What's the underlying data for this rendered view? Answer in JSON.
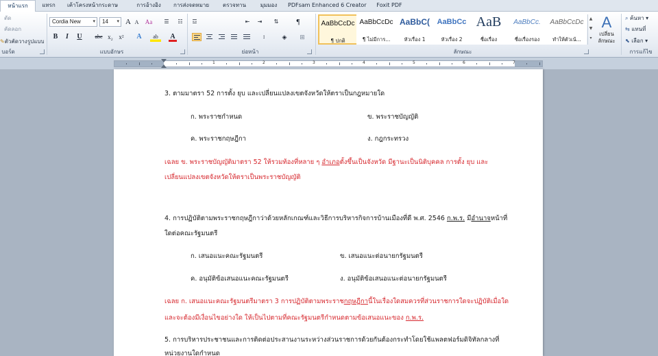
{
  "tabs": [
    "หน้าแรก",
    "แทรก",
    "เค้าโครงหน้ากระดาษ",
    "การอ้างอิง",
    "การส่งจดหมาย",
    "ตรวจทาน",
    "มุมมอง",
    "PDFsam Enhanced 6 Creator",
    "Foxit PDF"
  ],
  "clipboard": {
    "cut": "ตัด",
    "copy": "คัดลอก",
    "format_painter": "ตัวคัดวางรูปแบบ",
    "group_label": "บอร์ด"
  },
  "font": {
    "name": "Cordia New",
    "size": "14",
    "group_label": "แบบอักษร",
    "grow": "A",
    "shrink": "A",
    "clear": "Aa",
    "bold": "B",
    "italic": "I",
    "underline": "U",
    "strike": "abc",
    "sub": "x₂",
    "sup": "x²",
    "color_a": "A",
    "highlight": "ab",
    "pilcrow": "¶"
  },
  "paragraph": {
    "group_label": "ย่อหน้า",
    "pilcrow": "¶"
  },
  "styles": {
    "group_label": "ลักษณะ",
    "items": [
      {
        "preview": "AaBbCcDc",
        "name": "¶ ปกติ"
      },
      {
        "preview": "AaBbCcDc",
        "name": "¶ ไม่มีการ..."
      },
      {
        "preview": "AaBbC(",
        "name": "หัวเรื่อง 1"
      },
      {
        "preview": "AaBbCc",
        "name": "หัวเรื่อง 2"
      },
      {
        "preview": "AaB",
        "name": "ชื่อเรื่อง"
      },
      {
        "preview": "AaBbCc.",
        "name": "ชื่อเรื่องรอง"
      },
      {
        "preview": "AaBbCcDc",
        "name": "ทำให้ตัวเน้..."
      }
    ],
    "change_styles": "เปลี่ยน\nลักษณะ"
  },
  "editing": {
    "find": "ค้นหา",
    "replace": "แทนที่",
    "select": "เลือก",
    "group_label": "การแก้ไข"
  },
  "ruler_numbers": [
    "1",
    "2",
    "3",
    "4",
    "5",
    "6",
    "7"
  ],
  "document": {
    "q3": "3. ตามมาตรา 52 การตั้ง ยุบ และเปลี่ยนแปลงเขตจังหวัดให้ตราเป็นกฎหมายใด",
    "q3_a": "ก. พระราชกำหนด",
    "q3_b": "ข. พระราชบัญญัติ",
    "q3_c": "ค. พระราชกฤษฎีกา",
    "q3_d": "ง. กฎกระทรวง",
    "q3_ans1_pre": "เฉลย ข. พระราชบัญญัติมาตรา 52 ให้รวมท้องที่หลาย ๆ ",
    "q3_ans1_u": "อำเภอ",
    "q3_ans1_post": "ตั้งขึ้นเป็นจังหวัด มีฐานะเป็นนิติบุคคล การตั้ง ยุบ และ",
    "q3_ans2": "เปลี่ยนแปลงเขตจังหวัดให้ตราเป็นพระราชบัญญัติ",
    "q4_l1_pre": "4. การปฏิบัติตามพระราชกฤษฎีกาว่าด้วยหลักเกณฑ์และวิธีการบริหารกิจการบ้านเมืองที่ดี พ.ศ. 2546 ",
    "q4_l1_u1": "ก.พ.ร.",
    "q4_l1_mid": " มี",
    "q4_l1_u2": "อำนาจ",
    "q4_l1_post": "หน้าที่",
    "q4_l2": "ใดต่อคณะรัฐมนตรี",
    "q4_a": "ก. เสนอแนะคณะรัฐมนตรี",
    "q4_b": "ข. เสนอแนะต่อนายกรัฐมนตรี",
    "q4_c": "ค. อนุมัติข้อเสนอแนะคณะรัฐมนตรี",
    "q4_d": "ง. อนุมัติข้อเสนอแนะต่อนายกรัฐมนตรี",
    "q4_ans1_pre": "เฉลย ก. เสนอแนะคณะรัฐมนตรีมาตรา 3 การปฏิบัติตามพระราช",
    "q4_ans1_u": "กฤษฎีกา",
    "q4_ans1_post": "นี้ในเรื่องใดสมควรที่ส่วนราชการใดจะปฏิบัติเมื่อใด",
    "q4_ans2_pre": "และจะต้องมีเงื่อนไขอย่างใด ให้เป็นไปตามที่คณะรัฐมนตรีกำหนดตามข้อเสนอแนะของ ",
    "q4_ans2_u": "ก.พ.ร.",
    "q5_l1": "5. การบริหารประชาชนและการติดต่อประสานงานระหว่างส่วนราชการด้วยกันต้องกระทำโดยใช้แพลตฟอร์มดิจิทัลกลางที่",
    "q5_l2": "หน่วยงานใดกำหนด"
  },
  "colors": {
    "answer_red": "#d6262c",
    "active_style": "#f1c15a",
    "ribbon_bg": "#e8edf4"
  }
}
